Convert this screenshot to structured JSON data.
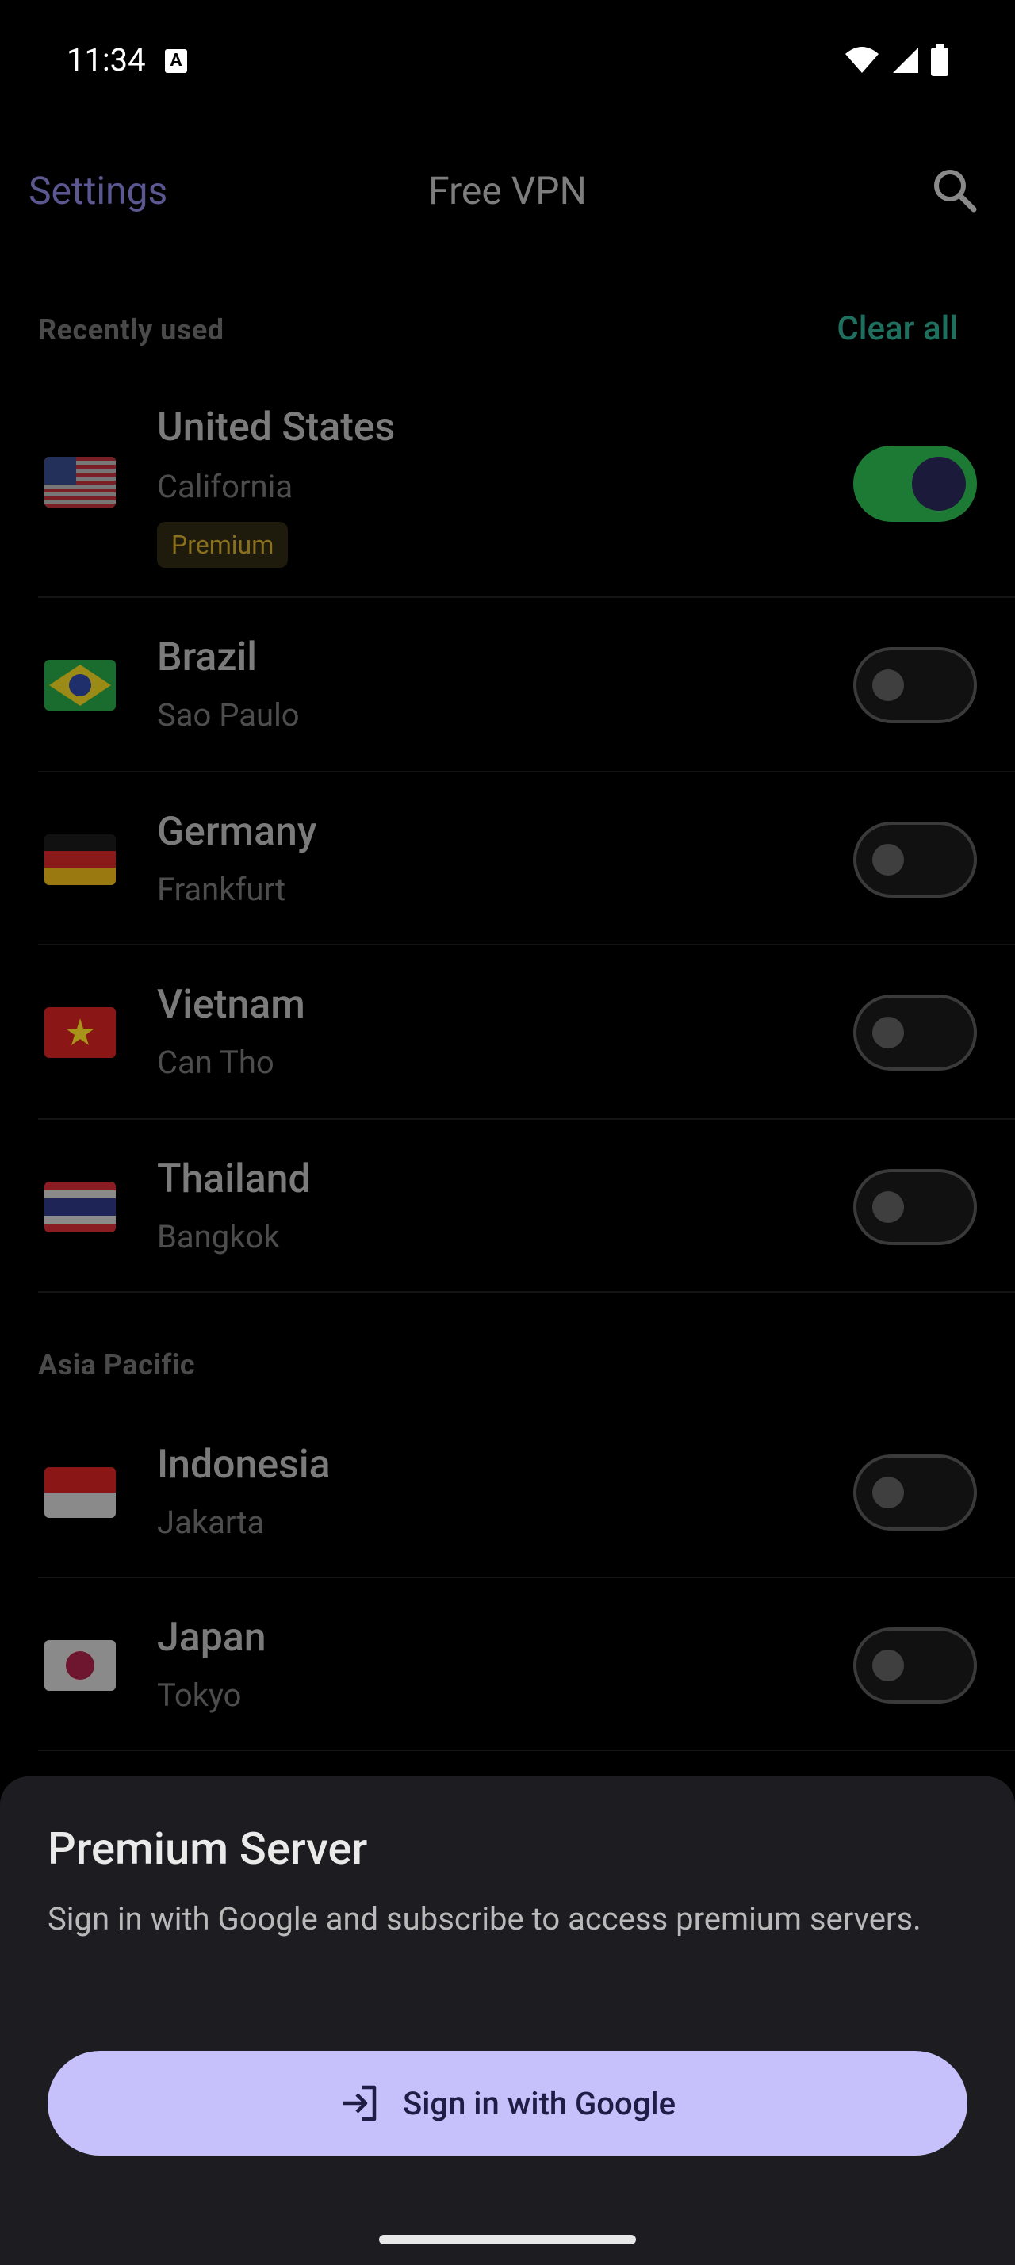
{
  "status_bar": {
    "time": "11:34",
    "notification_glyph": "A"
  },
  "app_bar": {
    "settings_label": "Settings",
    "title": "Free VPN",
    "search_icon": "search-icon"
  },
  "recent": {
    "header": "Recently used",
    "clear_all": "Clear all",
    "items": [
      {
        "country": "United States",
        "city": "California",
        "badge": "Premium",
        "enabled": true
      },
      {
        "country": "Brazil",
        "city": "Sao Paulo",
        "enabled": false
      },
      {
        "country": "Germany",
        "city": "Frankfurt",
        "enabled": false
      },
      {
        "country": "Vietnam",
        "city": "Can Tho",
        "enabled": false
      },
      {
        "country": "Thailand",
        "city": "Bangkok",
        "enabled": false
      }
    ]
  },
  "asia_pacific": {
    "header": "Asia Pacific",
    "items": [
      {
        "country": "Indonesia",
        "city": "Jakarta",
        "enabled": false
      },
      {
        "country": "Japan",
        "city": "Tokyo",
        "enabled": false
      }
    ]
  },
  "sheet": {
    "title": "Premium Server",
    "description": "Sign in with Google and subscribe to access premium servers.",
    "button_label": "Sign in with Google"
  },
  "colors": {
    "accent": "#c6c1fb",
    "toggle_on": "#1d7a34",
    "background": "#000000",
    "sheet": "#1d1c20"
  }
}
